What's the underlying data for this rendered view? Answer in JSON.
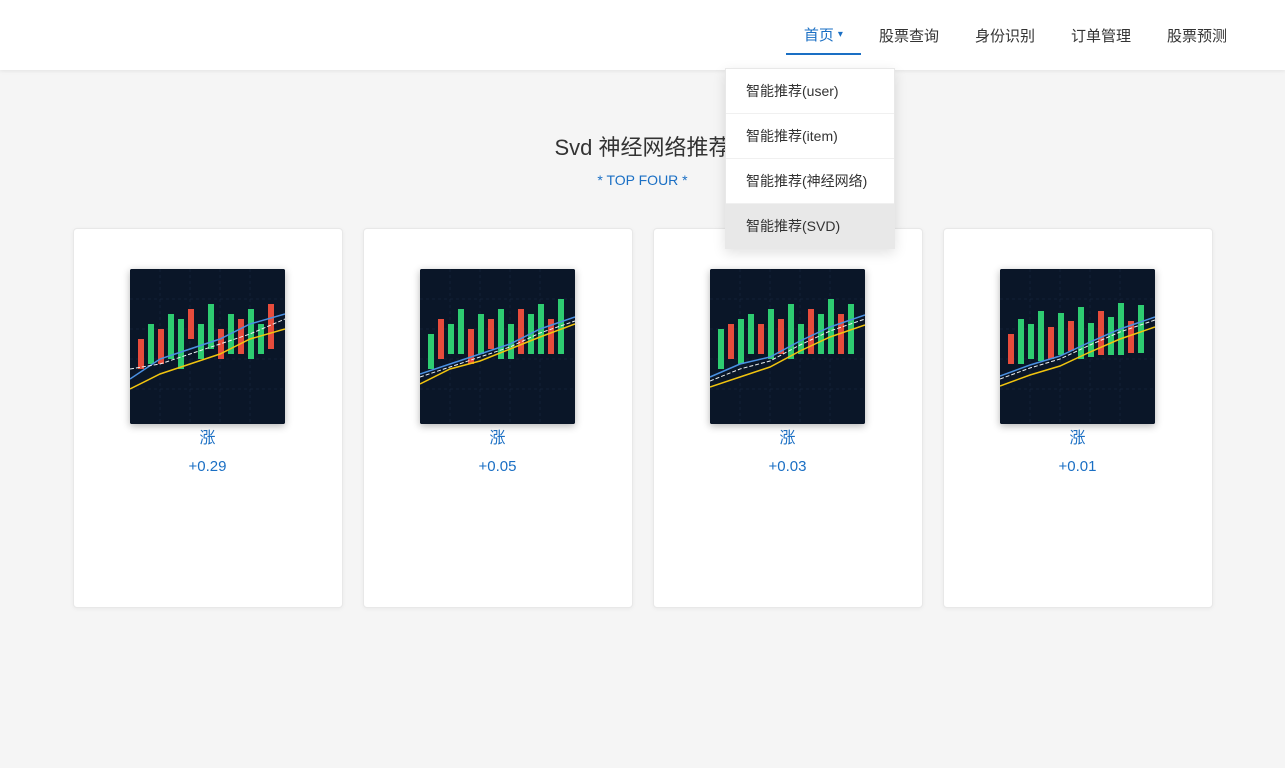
{
  "header": {
    "nav_items": [
      {
        "label": "首页",
        "active": true,
        "has_dropdown": true
      },
      {
        "label": "股票查询",
        "active": false,
        "has_dropdown": false
      },
      {
        "label": "身份识别",
        "active": false,
        "has_dropdown": false
      },
      {
        "label": "订单管理",
        "active": false,
        "has_dropdown": false
      },
      {
        "label": "股票预测",
        "active": false,
        "has_dropdown": false
      }
    ],
    "dropdown": {
      "items": [
        {
          "label": "智能推荐(user)",
          "selected": false
        },
        {
          "label": "智能推荐(item)",
          "selected": false
        },
        {
          "label": "智能推荐(神经网络)",
          "selected": false
        },
        {
          "label": "智能推荐(SVD)",
          "selected": true
        }
      ]
    }
  },
  "main": {
    "title": "Svd 神经网络推荐",
    "subtitle": "* TOP FOUR *",
    "cards": [
      {
        "label": "涨",
        "value": "+0.29"
      },
      {
        "label": "涨",
        "value": "+0.05"
      },
      {
        "label": "涨",
        "value": "+0.03"
      },
      {
        "label": "涨",
        "value": "+0.01"
      }
    ]
  }
}
